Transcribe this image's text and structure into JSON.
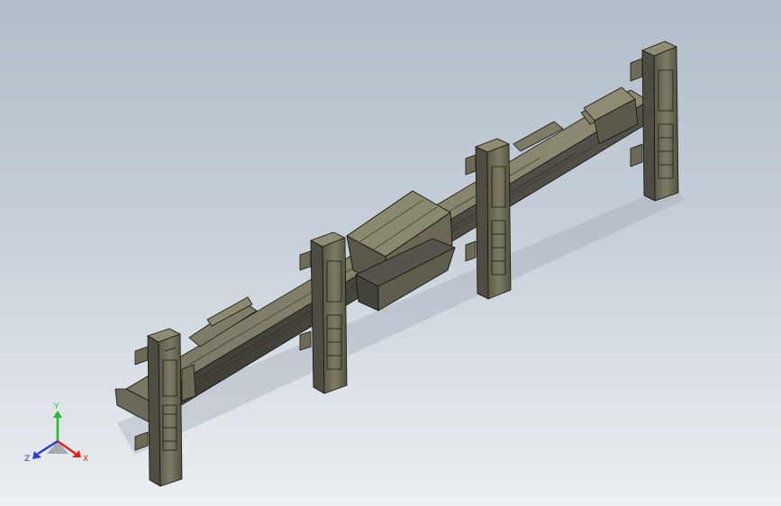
{
  "viewport": {
    "background_top": "#b2bdc9",
    "background_bottom": "#eceff2",
    "model_fill": "#6e6c5a",
    "model_fill_light": "#8d8a72",
    "model_fill_dark": "#4b4a3e",
    "edge_color": "#15150f"
  },
  "triad": {
    "x_label": "X",
    "y_label": "Y",
    "z_label": "Z",
    "x_color": "#e0221c",
    "y_color": "#1fbf2a",
    "z_color": "#2a3bd8"
  }
}
